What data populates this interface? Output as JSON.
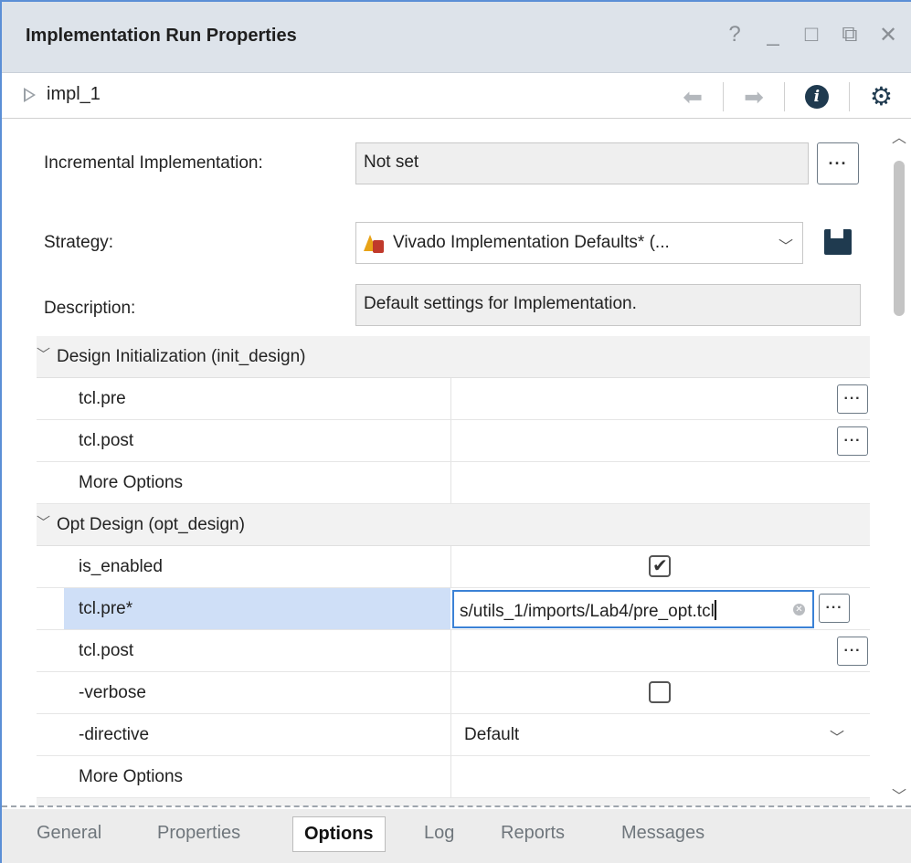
{
  "window": {
    "title": "Implementation Run Properties",
    "controls": [
      "?",
      "_",
      "□",
      "⧉",
      "✕"
    ]
  },
  "toolbar": {
    "run_name": "impl_1",
    "icons": [
      "back-arrow-icon",
      "forward-arrow-icon",
      "info-icon",
      "gear-icon"
    ]
  },
  "form": {
    "incremental_label": "Incremental Implementation:",
    "incremental_value": "Not set",
    "strategy_label": "Strategy:",
    "strategy_value": "Vivado Implementation Defaults* (...",
    "description_label": "Description:",
    "description_value": "Default settings for Implementation.",
    "browse_dots": "···"
  },
  "groups": [
    {
      "title": "Design Initialization (init_design)",
      "rows": [
        {
          "name": "tcl.pre"
        },
        {
          "name": "tcl.post"
        },
        {
          "name": "More Options"
        }
      ]
    },
    {
      "title": "Opt Design (opt_design)",
      "rows": [
        {
          "name": "is_enabled",
          "checked": true
        },
        {
          "name": "tcl.pre*",
          "value": "s/utils_1/imports/Lab4/pre_opt.tcl",
          "selected": true
        },
        {
          "name": "tcl.post"
        },
        {
          "name": "-verbose",
          "checked": false
        },
        {
          "name": "-directive",
          "value": "Default"
        },
        {
          "name": "More Options"
        }
      ]
    }
  ],
  "tabs": [
    "General",
    "Properties",
    "Options",
    "Log",
    "Reports",
    "Messages"
  ],
  "active_tab": "Options",
  "colors": {
    "selection": "#cfdff7",
    "focus_border": "#3b82d6",
    "accent_dark": "#1f3a4f"
  }
}
